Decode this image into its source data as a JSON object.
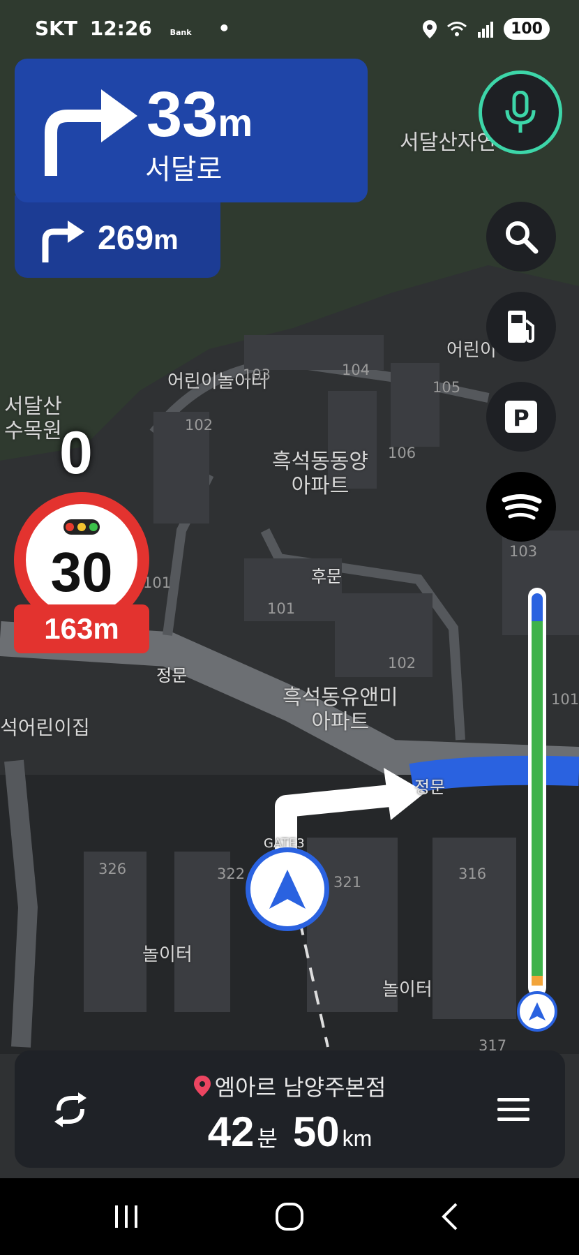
{
  "status_bar": {
    "carrier": "SKT",
    "time": "12:26",
    "bank_label": "Bank",
    "battery": "100"
  },
  "guidance": {
    "main_distance": "33",
    "main_unit": "m",
    "main_road": "서달로",
    "next_distance": "269",
    "next_unit": "m"
  },
  "speed": {
    "current": "0",
    "limit": "30",
    "camera_distance": "163m"
  },
  "map_labels": {
    "park_top": "서달산자연",
    "park_left": "서달산\n수목원",
    "playground_top": "어린이놀이터",
    "playground_right": "어린이",
    "apt1": "흑석동동양\n아파트",
    "apt2": "흑석동유앤미\n아파트",
    "daycare": "석어린이집",
    "back_gate": "후문",
    "main_gate1": "정문",
    "main_gate2": "정문",
    "gate3": "GATE3",
    "playground_b1": "놀이터",
    "playground_b2": "놀이터",
    "buildings": [
      "103",
      "104",
      "105",
      "102",
      "106",
      "101",
      "101",
      "102",
      "103",
      "101",
      "326",
      "322",
      "321",
      "316",
      "317"
    ]
  },
  "destination": {
    "name": "엠아르 남양주본점",
    "eta_minutes": "42",
    "eta_min_unit": "분",
    "distance": "50",
    "distance_unit": "km"
  },
  "route_progress": {
    "remaining_fraction": 0.93
  },
  "colors": {
    "turn_panel": "#1f45a8",
    "route_blue": "#2a62e0",
    "progress_green": "#3fb24a",
    "speed_red": "#e3332f",
    "mic_ring": "#3dd6a9"
  },
  "icons": [
    "turn-right-icon",
    "mic-icon",
    "search-icon",
    "fuel-icon",
    "parking-icon",
    "spotify-icon",
    "car-position-icon",
    "reroute-icon",
    "menu-icon",
    "destination-pin-icon"
  ]
}
